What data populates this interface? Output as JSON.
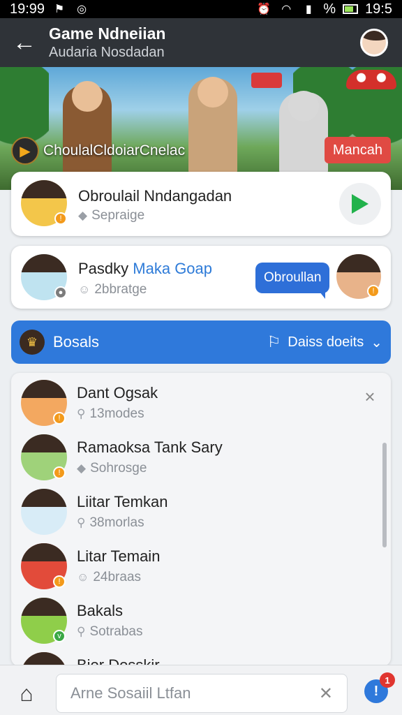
{
  "status_bar": {
    "time": "19:99",
    "right_text": "19:5",
    "battery_percent": "%"
  },
  "header": {
    "title": "Game Ndneiian",
    "subtitle": "Audaria Nosdadan"
  },
  "banner": {
    "label": "ChoulalCldoiarCnelac",
    "action_label": "Mancah"
  },
  "cards": [
    {
      "name": "Obroulail Nndangadan",
      "sub": "Sepraige"
    },
    {
      "name_prefix": "Pasdky",
      "name_highlight": "Maka Goap",
      "sub": "2bbratge",
      "action_label": "Obroullan"
    }
  ],
  "section": {
    "title": "Bosals",
    "action_label": "Daiss doeits"
  },
  "list": [
    {
      "name": "Dant Ogsak",
      "sub": "13modes",
      "highlight": false
    },
    {
      "name": "Ramaoksa Tank Sary",
      "sub": "Sohrosge",
      "highlight": true
    },
    {
      "name": "Liitar Temkan",
      "sub": "38morlas",
      "highlight": false
    },
    {
      "name": "Litar Temain",
      "sub": "24braas",
      "highlight": false
    },
    {
      "name": "Bakals",
      "sub": "Sotrabas",
      "highlight": false
    },
    {
      "name": "Bior Dosskir",
      "sub": "",
      "highlight": false
    }
  ],
  "bottom": {
    "search_placeholder": "Arne Sosaiil Ltfan",
    "notification_count": "1"
  }
}
